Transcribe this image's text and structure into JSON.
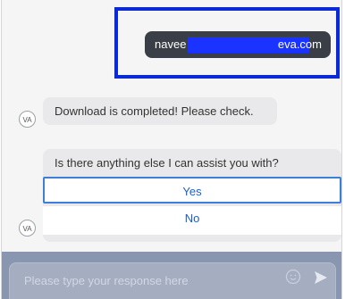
{
  "user_message": {
    "visible_start": "navee",
    "visible_end": "eva.com",
    "redaction_color": "#1a33ff",
    "highlight_color": "#0a2ad8"
  },
  "bot": {
    "avatar_label": "VA",
    "message_1": "Download is completed! Please check.",
    "message_2": "Is there anything else I can assist you with?",
    "options": [
      "Yes",
      "No"
    ]
  },
  "composer": {
    "placeholder": "Please type your response here",
    "emoji_icon": "emoji-icon",
    "send_icon": "send-icon"
  }
}
